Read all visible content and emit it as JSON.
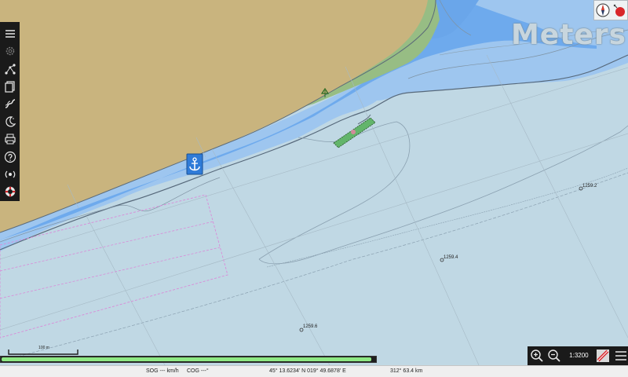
{
  "map": {
    "units_label": "Meters",
    "soundings": [
      {
        "value": "1259.2"
      },
      {
        "value": "1259.4"
      },
      {
        "value": "1259.6"
      }
    ],
    "scale_bar_label": "100 m"
  },
  "toolbar": {
    "items": [
      {
        "name": "menu-icon",
        "icon": "hamburger"
      },
      {
        "name": "settings-icon",
        "icon": "gear"
      },
      {
        "name": "route-icon",
        "icon": "route"
      },
      {
        "name": "documents-icon",
        "icon": "document"
      },
      {
        "name": "track-icon",
        "icon": "track"
      },
      {
        "name": "tide-current-icon",
        "icon": "moon"
      },
      {
        "name": "print-icon",
        "icon": "printer"
      },
      {
        "name": "help-icon",
        "icon": "question"
      },
      {
        "name": "ais-icon",
        "icon": "ais"
      },
      {
        "name": "mob-icon",
        "icon": "lifebuoy"
      }
    ]
  },
  "progress": {
    "fraction": 0.99
  },
  "zoom": {
    "scale_value": "1:3200"
  },
  "status": {
    "sog": "SOG --- km/h",
    "cog": "COG ---°",
    "position": "45° 13.6234' N  019° 49.6878' E",
    "bearing_distance": "312°  63.4 km"
  },
  "colors": {
    "land": "#c9b47e",
    "shallow": "#6aa8ec",
    "medium": "#9bc4ee",
    "deep": "#c0d8e4",
    "green_strip": "#97bd84",
    "toolbar_bg": "#1a1a1a",
    "progress_fill": "#8ee883"
  }
}
